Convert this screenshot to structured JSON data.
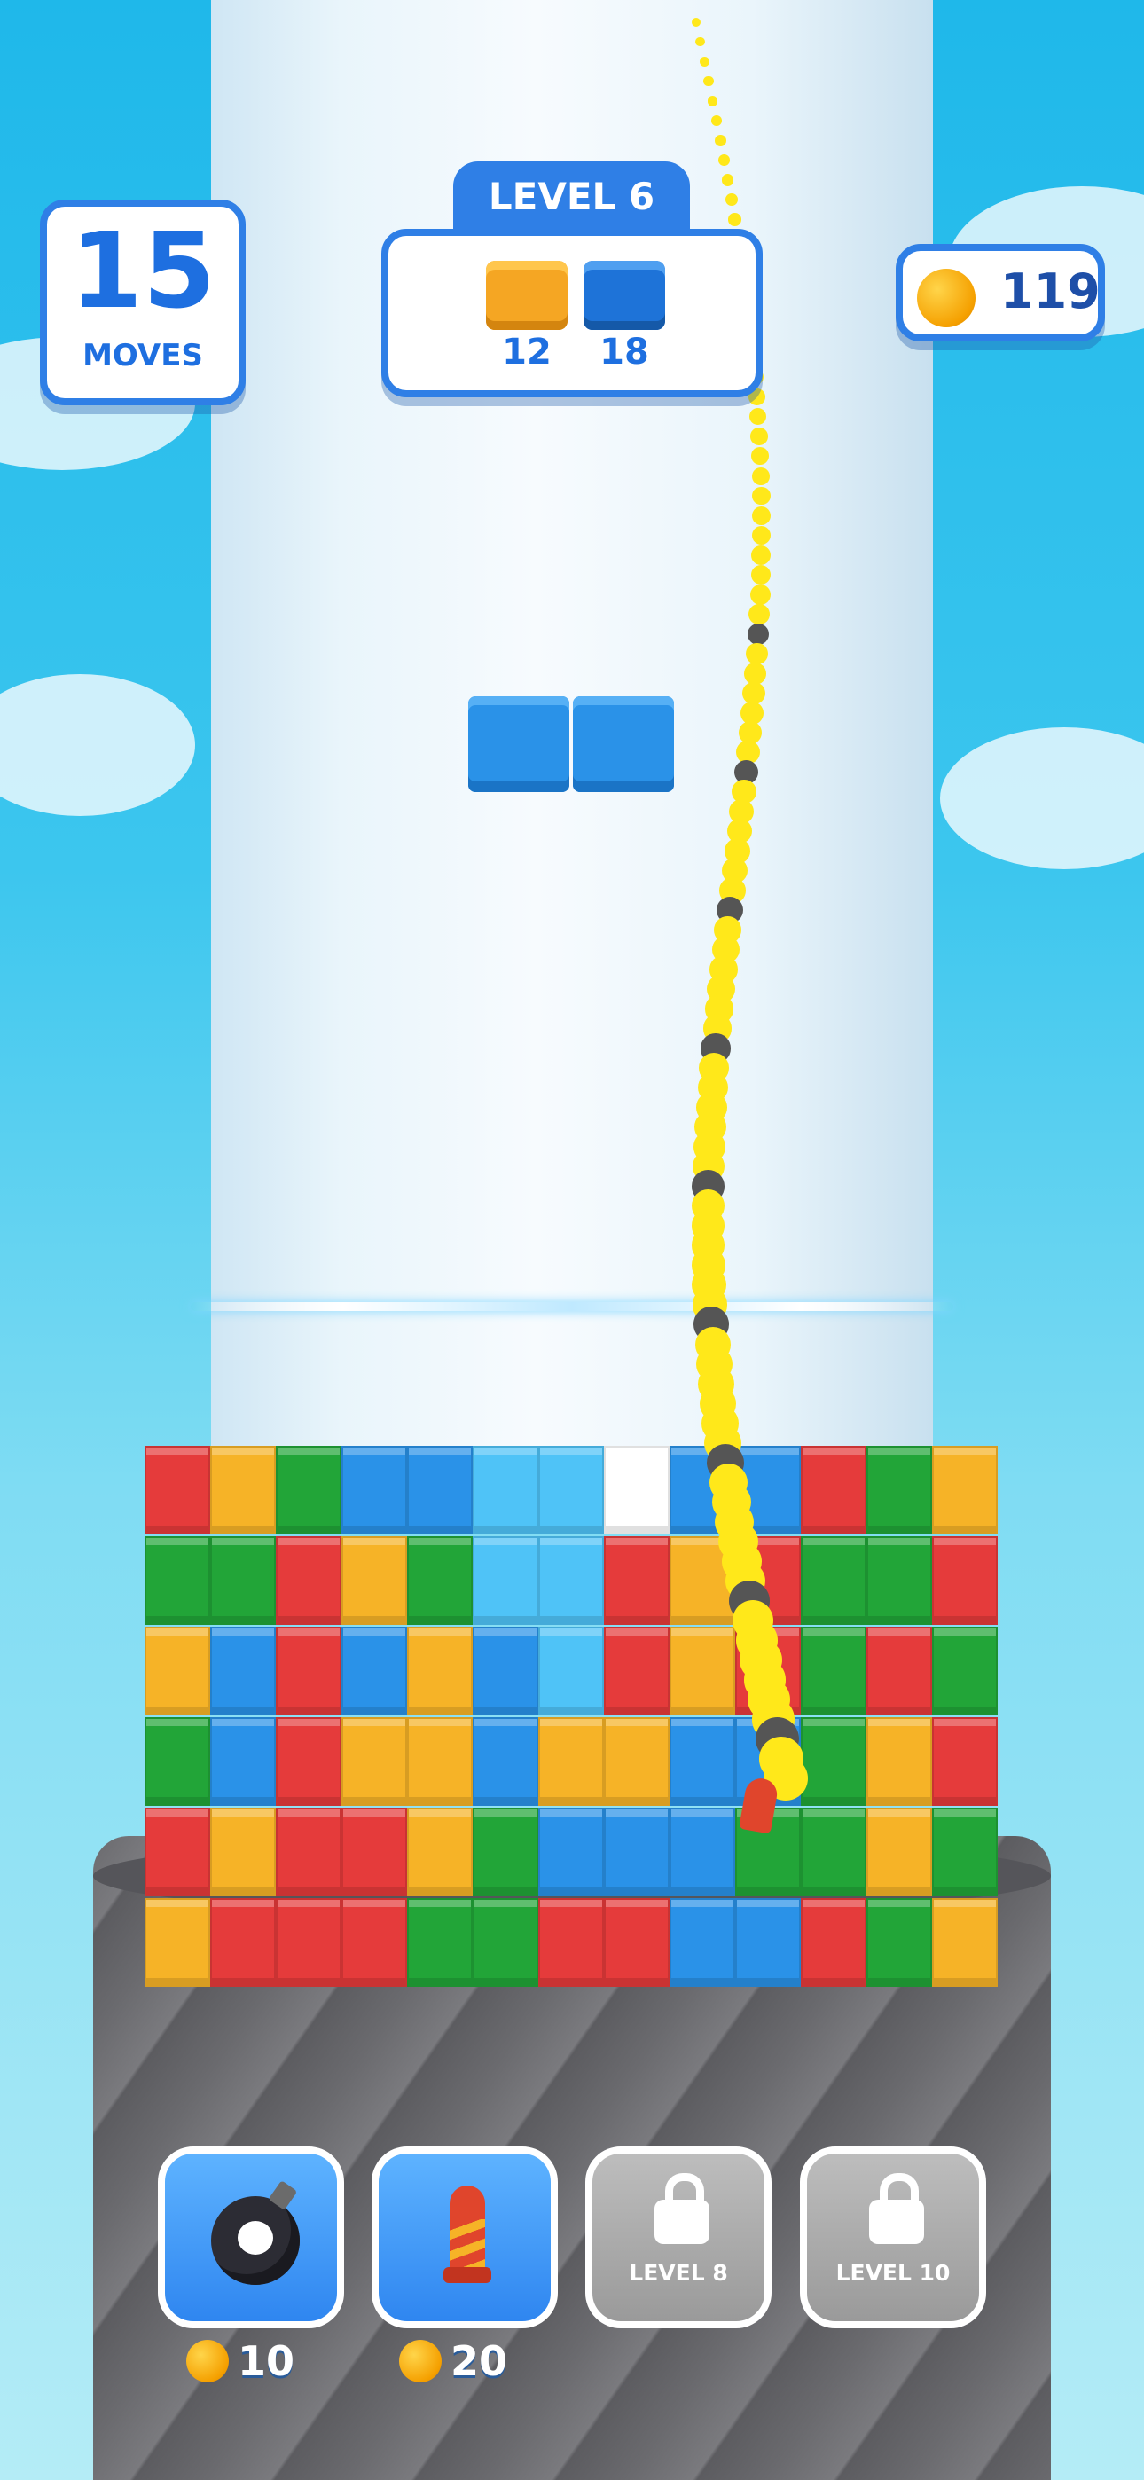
{
  "hud": {
    "moves": {
      "count": "15",
      "label": "MOVES"
    },
    "level": {
      "label": "LEVEL 6"
    },
    "goals": [
      {
        "color": "#f5a623",
        "count": "12"
      },
      {
        "color": "#1e73d8",
        "count": "18"
      }
    ],
    "coins": {
      "count": "119"
    }
  },
  "boosters": [
    {
      "icon": "bomb-icon",
      "price": "10",
      "locked": false
    },
    {
      "icon": "rocket-icon",
      "price": "20",
      "locked": false
    },
    {
      "icon": "lock-icon",
      "label": "LEVEL 8",
      "locked": true
    },
    {
      "icon": "lock-icon",
      "label": "LEVEL 10",
      "locked": true
    }
  ],
  "colors": {
    "red": "#e53b3b",
    "yellow": "#f6b327",
    "green": "#22a538",
    "blue": "#2a92e8",
    "light_blue": "#4fc3f7",
    "accent": "#2f7fe6"
  },
  "grid": [
    [
      "red",
      "yellow",
      "green",
      "blue",
      "blue",
      "light_blue",
      "light_blue",
      "white",
      "blue",
      "blue",
      "red",
      "green",
      "yellow"
    ],
    [
      "green",
      "green",
      "red",
      "yellow",
      "green",
      "light_blue",
      "light_blue",
      "red",
      "yellow",
      "red",
      "green",
      "green",
      "red"
    ],
    [
      "yellow",
      "blue",
      "red",
      "blue",
      "yellow",
      "blue",
      "light_blue",
      "red",
      "yellow",
      "red",
      "green",
      "red",
      "green"
    ],
    [
      "green",
      "blue",
      "red",
      "yellow",
      "yellow",
      "blue",
      "yellow",
      "yellow",
      "blue",
      "blue",
      "green",
      "yellow",
      "red"
    ],
    [
      "red",
      "yellow",
      "red",
      "red",
      "yellow",
      "green",
      "blue",
      "blue",
      "blue",
      "green",
      "green",
      "yellow",
      "green"
    ],
    [
      "yellow",
      "red",
      "red",
      "red",
      "green",
      "green",
      "red",
      "red",
      "blue",
      "blue",
      "red",
      "green",
      "yellow"
    ]
  ]
}
